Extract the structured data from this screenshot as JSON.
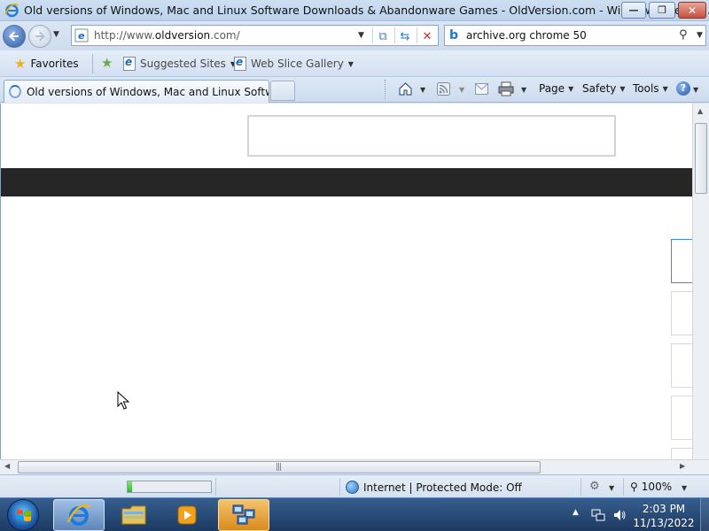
{
  "window": {
    "title": "Old versions of Windows, Mac and Linux Software Downloads & Abandonware Games - OldVersion.com - Windows Internet ...",
    "minimize_label": "—",
    "maximize_label": "❐",
    "close_label": "✕"
  },
  "address_bar": {
    "url_prefix": "http://www.",
    "url_domain": "oldversion",
    "url_suffix": ".com/",
    "search_query": "archive.org chrome 50"
  },
  "favorites_bar": {
    "favorites_label": "Favorites",
    "items": [
      {
        "label": "Suggested Sites"
      },
      {
        "label": "Web Slice Gallery"
      }
    ]
  },
  "tabs": [
    {
      "label": "Old versions of Windows, Mac and Linux Softwar..."
    }
  ],
  "command_bar": {
    "page_label": "Page",
    "safety_label": "Safety",
    "tools_label": "Tools"
  },
  "status_bar": {
    "zone_text": "Internet | Protected Mode: Off",
    "zoom_text": "100%",
    "progress": 0.05
  },
  "taskbar": {
    "time": "2:03 PM",
    "date": "11/13/2022"
  },
  "colors": {
    "dark_band": "#262626",
    "accent_blue": "#3a8ad6"
  }
}
